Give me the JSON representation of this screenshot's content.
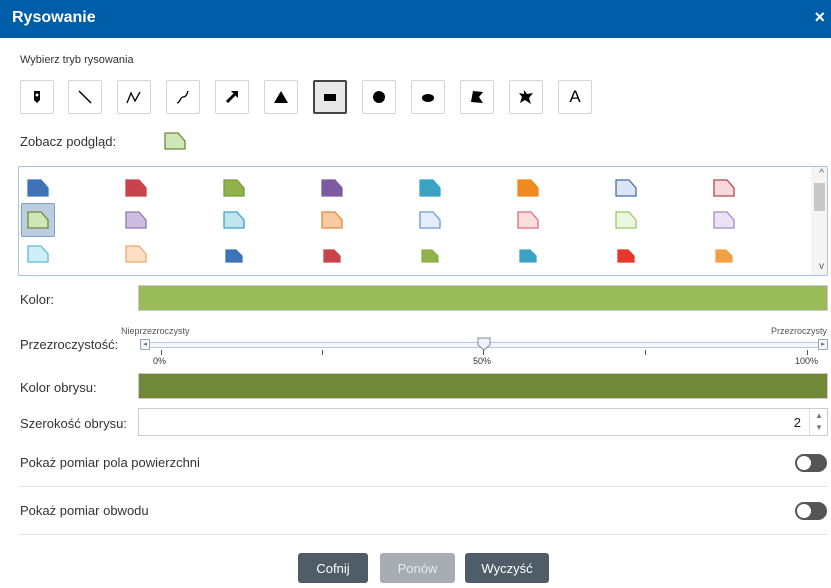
{
  "window": {
    "title": "Rysowanie",
    "close_glyph": "×"
  },
  "mode_label": "Wybierz tryb rysowania",
  "tools": [
    {
      "name": "point-tool",
      "icon": "pin-icon"
    },
    {
      "name": "line-tool",
      "icon": "line-icon"
    },
    {
      "name": "polyline-tool",
      "icon": "polyline-icon"
    },
    {
      "name": "freehand-line-tool",
      "icon": "freehand-line-icon"
    },
    {
      "name": "arrow-tool",
      "icon": "arrow-icon"
    },
    {
      "name": "triangle-tool",
      "icon": "triangle-icon"
    },
    {
      "name": "rectangle-tool",
      "icon": "rectangle-icon",
      "active": true
    },
    {
      "name": "circle-tool",
      "icon": "circle-icon"
    },
    {
      "name": "ellipse-tool",
      "icon": "ellipse-icon"
    },
    {
      "name": "polygon-tool",
      "icon": "polygon-icon"
    },
    {
      "name": "freehand-polygon-tool",
      "icon": "freehand-polygon-icon"
    },
    {
      "name": "text-tool",
      "icon": "text-icon",
      "label": "A"
    }
  ],
  "preview": {
    "label": "Zobacz podgląd:",
    "fill": "#cfe6b8",
    "stroke": "#6f8a3b"
  },
  "symbols": [
    {
      "fill": "#3e73b8",
      "stroke": "#3e73b8"
    },
    {
      "fill": "#c9434b",
      "stroke": "#c9434b"
    },
    {
      "fill": "#8fb24a",
      "stroke": "#7a9a3c"
    },
    {
      "fill": "#7e5aa3",
      "stroke": "#7e5aa3"
    },
    {
      "fill": "#3ba3c2",
      "stroke": "#3ba3c2"
    },
    {
      "fill": "#ef8a1f",
      "stroke": "#ef8a1f"
    },
    {
      "fill": "#d9e6f5",
      "stroke": "#4a6ea3"
    },
    {
      "fill": "#f6dada",
      "stroke": "#b8454f"
    },
    {
      "fill": "#cfe6b8",
      "stroke": "#6f8a3b",
      "selected": true
    },
    {
      "fill": "#cdbde0",
      "stroke": "#8e79b0"
    },
    {
      "fill": "#bfe6ef",
      "stroke": "#3ba3c2"
    },
    {
      "fill": "#f6c9a0",
      "stroke": "#e08a3c"
    },
    {
      "fill": "#e2eefb",
      "stroke": "#6d98cc"
    },
    {
      "fill": "#fcdede",
      "stroke": "#e06d7a"
    },
    {
      "fill": "#ecf7df",
      "stroke": "#9cc96b"
    },
    {
      "fill": "#ece2f6",
      "stroke": "#a18ac6"
    },
    {
      "fill": "#cfeff8",
      "stroke": "#57bcd9"
    },
    {
      "fill": "#fde0c6",
      "stroke": "#f5a664"
    },
    {
      "fill": "#3e73b8",
      "stroke": "#3e73b8",
      "small": true
    },
    {
      "fill": "#c9434b",
      "stroke": "#c9434b",
      "small": true
    },
    {
      "fill": "#8fb24a",
      "stroke": "#8fb24a",
      "small": true
    },
    {
      "fill": "#3ba3c2",
      "stroke": "#3ba3c2",
      "small": true
    },
    {
      "fill": "#e8372a",
      "stroke": "#e8372a",
      "small": true
    },
    {
      "fill": "#f2a044",
      "stroke": "#f2a044",
      "small": true
    }
  ],
  "color": {
    "label": "Kolor:",
    "value": "#9abb59"
  },
  "opacity": {
    "label": "Przezroczystość:",
    "min_label": "Nieprzezroczysty",
    "max_label": "Przezroczysty",
    "value": 0.5,
    "ticks": [
      "0%",
      "50%",
      "100%"
    ]
  },
  "outline_color": {
    "label": "Kolor obrysu:",
    "value": "#708838"
  },
  "outline_width": {
    "label": "Szerokość obrysu:",
    "value": "2"
  },
  "toggles": [
    {
      "label": "Pokaż pomiar pola powierzchni",
      "on": false
    },
    {
      "label": "Pokaż pomiar obwodu",
      "on": false
    }
  ],
  "buttons": {
    "undo": "Cofnij",
    "redo": "Ponów",
    "clear": "Wyczyść"
  }
}
